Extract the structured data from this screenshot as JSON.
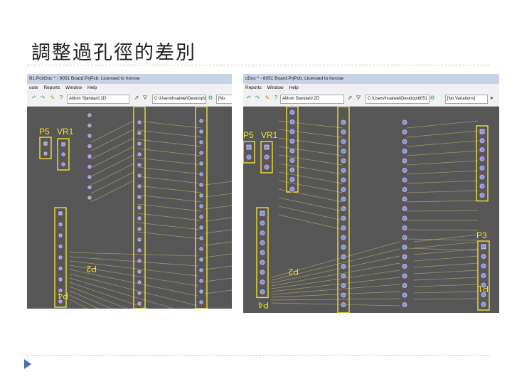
{
  "slide": {
    "title": "調整過孔徑的差別"
  },
  "screenshots": [
    {
      "titlebar": "B1.PcbDoc * - 8051 Board.PrjPcb. Licensed to horose",
      "menu": [
        "oute",
        "Reports",
        "Window",
        "Help"
      ],
      "path": "C:\\Users\\huaiwei\\Desktop\\8051",
      "view_mode": "Altium Standard 2D",
      "variant": "[No",
      "labels": {
        "p5": "P5",
        "vr1": "VR1",
        "p2": "P2",
        "p4": "P4"
      }
    },
    {
      "titlebar": "cDoc * - 8051 Board.PrjPcb. Licensed to horose",
      "menu": [
        "Reports",
        "Window",
        "Help"
      ],
      "path": "C:\\Users\\huaiwei\\Desktop\\8051",
      "view_mode": "Altium Standard 2D",
      "variant": "[No Variations]",
      "labels": {
        "p5": "P5",
        "vr1": "VR1",
        "p2": "P2",
        "p4": "P4",
        "p1": "P1",
        "p3": "P3"
      }
    }
  ],
  "colors": {
    "board": "#575757",
    "silkscreen": "#f0e030",
    "pad_ring": "#7a3d7a",
    "pad_fill": "#b8c0c8",
    "via_hole": "#6aa0d8",
    "trace": "#b8b070"
  }
}
